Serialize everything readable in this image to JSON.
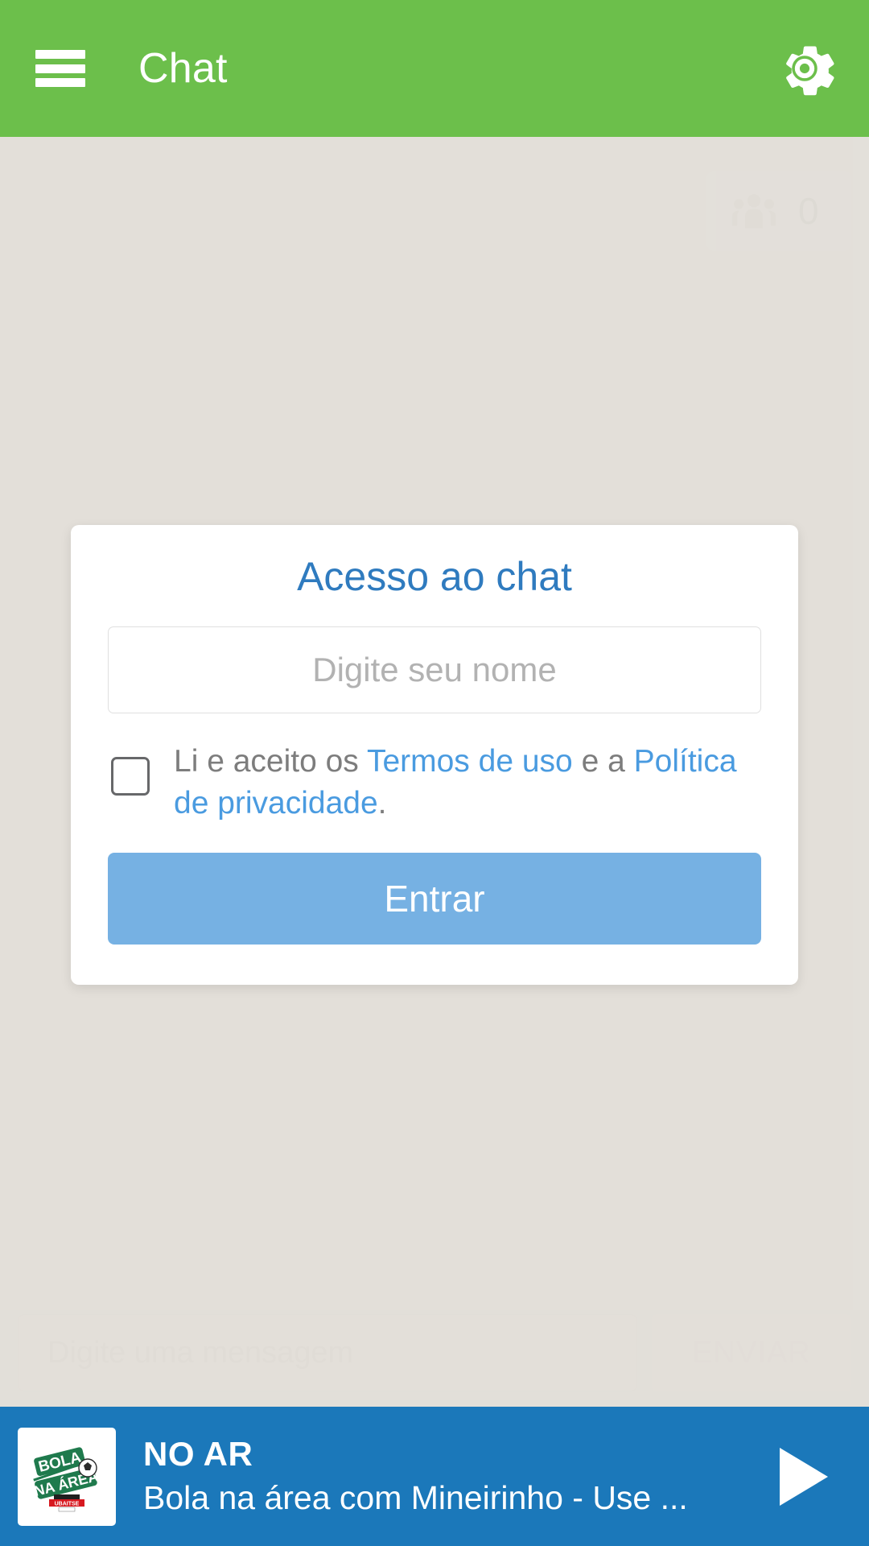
{
  "header": {
    "title": "Chat",
    "menu_icon": "hamburger-menu-icon",
    "settings_icon": "gear-icon"
  },
  "chat": {
    "viewers": {
      "icon": "users-group-icon",
      "count": "0"
    }
  },
  "composer": {
    "placeholder": "Digite uma mensagem",
    "send_label": "ENVIAR"
  },
  "modal": {
    "title": "Acesso ao chat",
    "name_placeholder": "Digite seu nome",
    "name_value": "",
    "terms": {
      "prefix": "Li e aceito os ",
      "link1": "Termos de uso",
      "middle": " e a ",
      "link2": "Política de privacidade",
      "suffix": "."
    },
    "submit_label": "Entrar",
    "checkbox_checked": false
  },
  "player": {
    "status": "NO AR",
    "title": "Bola na área com Mineirinho - Use ...",
    "artwork_alt": "BOLA NA ÁREA",
    "artwork_line1": "BOLA",
    "artwork_line2": "NA ÁREA",
    "artwork_badge": "UBAITSE",
    "play_icon": "play-icon"
  },
  "colors": {
    "header_green": "#6cbf4b",
    "accent_blue": "#2f7bbf",
    "link_blue": "#4a9be0",
    "button_blue": "#76b1e3",
    "player_blue": "#1b78ba",
    "page_bg": "#e3dfda"
  }
}
